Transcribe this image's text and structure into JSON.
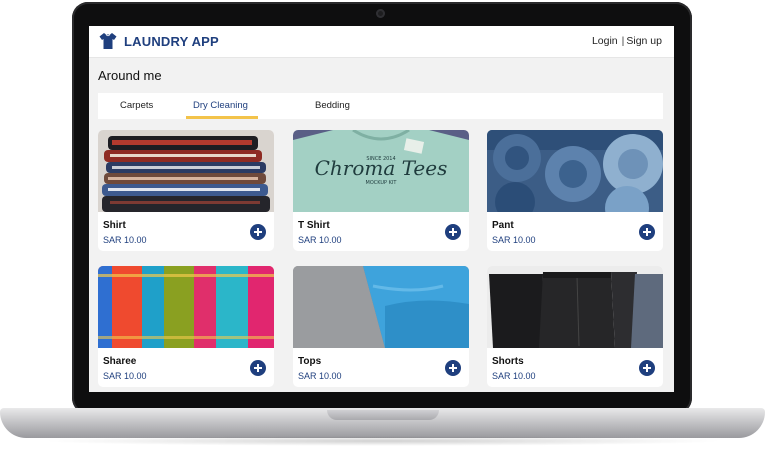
{
  "app": {
    "brand": "LAUNDRY APP",
    "login_label": "Login",
    "signup_label": "Sign up",
    "separator": "|"
  },
  "section": {
    "title": "Around me"
  },
  "tabs": [
    {
      "label": "Carpets",
      "active": false
    },
    {
      "label": "Dry Cleaning",
      "active": true
    },
    {
      "label": "Bedding",
      "active": false
    }
  ],
  "items": [
    {
      "name": "Shirt",
      "price": "SAR 10.00",
      "image": "folded-shirts-photo"
    },
    {
      "name": "T Shirt",
      "price": "SAR 10.00",
      "image": "printed-tshirt-photo"
    },
    {
      "name": "Pant",
      "price": "SAR 10.00",
      "image": "rolled-jeans-photo"
    },
    {
      "name": "Sharee",
      "price": "SAR 10.00",
      "image": "colorful-sarees-photo"
    },
    {
      "name": "Tops",
      "price": "SAR 10.00",
      "image": "folded-tops-photo"
    },
    {
      "name": "Shorts",
      "price": "SAR 10.00",
      "image": "black-shorts-photo"
    }
  ],
  "colors": {
    "brand": "#1f3f7e",
    "tab_underline": "#f3c34a",
    "background": "#f2f2f2"
  }
}
